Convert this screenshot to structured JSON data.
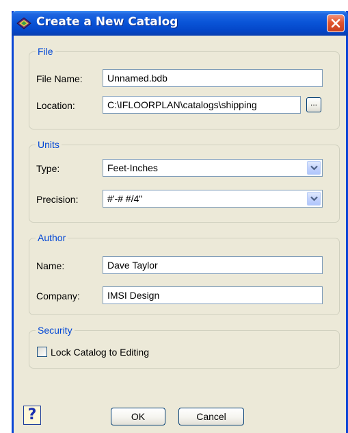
{
  "window": {
    "title": "Create a New Catalog",
    "icon": "catalog-book-icon",
    "close_icon": "close-icon"
  },
  "file_group": {
    "legend": "File",
    "file_name_label": "File Name:",
    "file_name_value": "Unnamed.bdb",
    "location_label": "Location:",
    "location_value": "C:\\IFLOORPLAN\\catalogs\\shipping",
    "browse_label": "..."
  },
  "units_group": {
    "legend": "Units",
    "type_label": "Type:",
    "type_value": "Feet-Inches",
    "precision_label": "Precision:",
    "precision_value": "#'-# #/4\""
  },
  "author_group": {
    "legend": "Author",
    "name_label": "Name:",
    "name_value": "Dave Taylor",
    "company_label": "Company:",
    "company_value": "IMSI Design"
  },
  "security_group": {
    "legend": "Security",
    "lock_label": "Lock Catalog to Editing",
    "lock_checked": false
  },
  "buttons": {
    "help_label": "?",
    "ok_label": "OK",
    "cancel_label": "Cancel"
  },
  "colors": {
    "title_bar": "#0a55d8",
    "window_border": "#0a46d6",
    "dialog_bg": "#ece9d8",
    "group_legend": "#0046d5",
    "close_button": "#e0542e"
  }
}
